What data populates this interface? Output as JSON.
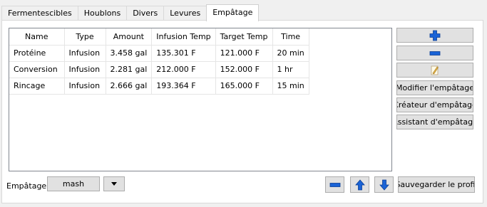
{
  "tabs": [
    "Fermentescibles",
    "Houblons",
    "Divers",
    "Levures",
    "Empâtage"
  ],
  "table": {
    "columns": [
      "Name",
      "Type",
      "Amount",
      "Infusion Temp",
      "Target Temp",
      "Time"
    ],
    "rows": [
      [
        "Protéine",
        "Infusion",
        "3.458 gal",
        "135.301 F",
        "121.000 F",
        "20 min"
      ],
      [
        "Conversion",
        "Infusion",
        "2.281 gal",
        "212.000 F",
        "152.000 F",
        "1 hr"
      ],
      [
        "Rincage",
        "Infusion",
        "2.666 gal",
        "193.364 F",
        "165.000 F",
        "15 min"
      ]
    ]
  },
  "side_buttons": {
    "add_icon": "plus-icon",
    "remove_icon": "minus-icon",
    "edit_icon": "edit-icon",
    "modify": "Modifier l'empâtage",
    "creator": "Créateur d'empâtage",
    "wizard": "Assistant d'empâtage"
  },
  "bottom": {
    "label": "Empâtage",
    "mash_name": "mash",
    "dropdown_icon": "chevron-down-icon",
    "remove_icon": "minus-icon",
    "up_icon": "arrow-up-icon",
    "down_icon": "arrow-down-icon",
    "save": "Sauvegarder le profil"
  },
  "colors": {
    "icon_blue": "#1a63d6",
    "panel": "#ffffff",
    "window": "#f0f0f0"
  }
}
